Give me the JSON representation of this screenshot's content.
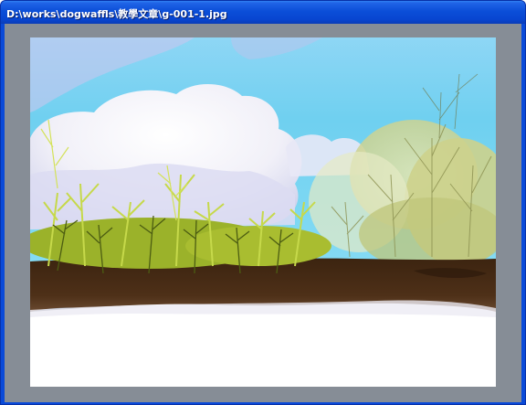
{
  "window": {
    "title": "D:\\works\\dogwaffls\\教學文章\\g-001-1.jpg"
  },
  "image": {
    "icon": "painted-landscape-image",
    "colors": {
      "frame_gray": "#868d96",
      "sky": "#72d3f0",
      "soil": "#4a2e16",
      "grass": "#b8cc3a",
      "foreground": "#ffffff"
    }
  }
}
